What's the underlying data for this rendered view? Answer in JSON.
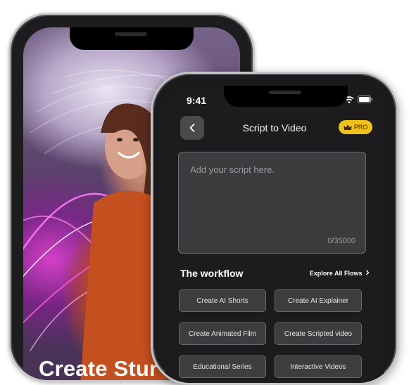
{
  "back_phone": {
    "hero_text": "Create Stur"
  },
  "front_phone": {
    "status_bar": {
      "time": "9:41"
    },
    "header": {
      "title": "Script to Video",
      "pro_badge": "PRO"
    },
    "script_input": {
      "placeholder": "Add your script here.",
      "counter": "0/35000"
    },
    "workflow": {
      "title": "The workflow",
      "explore_link": "Explore All Flows",
      "items": [
        "Create AI Shorts",
        "Create AI Explainer",
        "Create Animated Film",
        "Create Scripted video",
        "Educational Series",
        "Interactive Videos"
      ]
    }
  },
  "colors": {
    "pro_badge": "#f2c21a",
    "screen_bg": "#1c1c1e",
    "button_bg": "#3d3d40"
  },
  "icons": [
    "back-chevron-icon",
    "crown-icon",
    "signal-icon",
    "wifi-icon",
    "battery-icon",
    "chevron-right-icon"
  ]
}
